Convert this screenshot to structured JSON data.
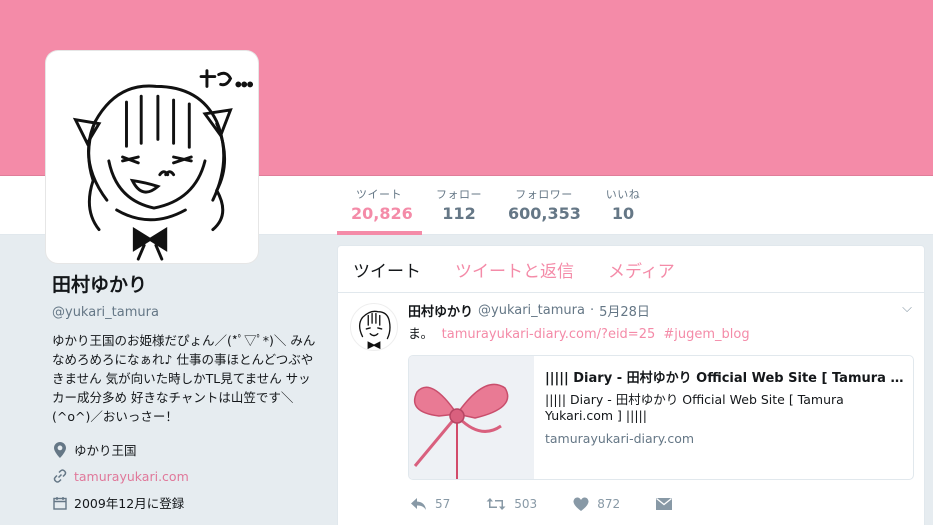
{
  "profile": {
    "display_name": "田村ゆかり",
    "handle": "@yukari_tamura",
    "bio": "ゆかり王国のお姫様だぴょん／(*ﾟ▽ﾟ*)＼ みんなめろめろになぁれ♪ 仕事の事ほとんどつぶやきません 気が向いた時しかTL見てません サッカー成分多め 好きなチャントは山笠です＼(^o^)／おいっさー！",
    "location": "ゆかり王国",
    "website": "tamurayukari.com",
    "joined": "2009年12月に登録"
  },
  "stats": [
    {
      "label": "ツイート",
      "value": "20,826",
      "active": true
    },
    {
      "label": "フォロー",
      "value": "112",
      "active": false
    },
    {
      "label": "フォロワー",
      "value": "600,353",
      "active": false
    },
    {
      "label": "いいね",
      "value": "10",
      "active": false
    }
  ],
  "timeline_tabs": [
    "ツイート",
    "ツイートと返信",
    "メディア"
  ],
  "tweet": {
    "name": "田村ゆかり",
    "handle": "@yukari_tamura",
    "date": "5月28日",
    "text": "ま。",
    "link": "tamurayukari-diary.com/?eid=25",
    "hashtag": "#jugem_blog",
    "card": {
      "title": "||||| Diary - 田村ゆかり Official Web Site [ Tamura Yukari.com ] |||||",
      "title_display": "||||| Diary - 田村ゆかり Official Web Site [ Tamura Yu...",
      "description": "||||| Diary - 田村ゆかり Official Web Site [ Tamura Yukari.com ] |||||",
      "domain": "tamurayukari-diary.com"
    },
    "actions": {
      "reply": "57",
      "retweet": "503",
      "like": "872"
    }
  },
  "colors": {
    "theme": "#f48ba8",
    "banner": "#f48ba8",
    "muted": "#657786",
    "link": "#e0789a"
  },
  "icons": {
    "location": "map-pin-icon",
    "website": "link-icon",
    "joined": "calendar-icon"
  }
}
